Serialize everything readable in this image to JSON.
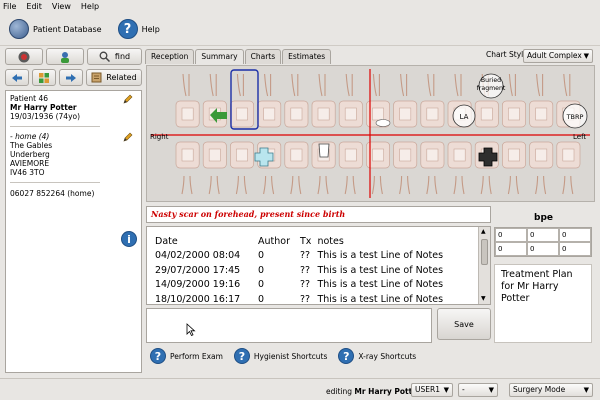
{
  "menu": [
    "File",
    "Edit",
    "View",
    "Help"
  ],
  "toolbar": {
    "patient_db": "Patient Database",
    "help": "Help"
  },
  "left": {
    "find_label": "find",
    "related_label": "Related",
    "patient_number": "Patient 46",
    "patient_name": "Mr Harry Potter",
    "patient_dob": "19/03/1936 (74yo)",
    "address_type": "- home (4)",
    "address_lines": [
      "The Gables",
      "Underberg",
      "AVIEMORE",
      "IV46 3TO"
    ],
    "phone": "06027 852264 (home)"
  },
  "tabs": [
    "Reception",
    "Summary",
    "Charts",
    "Estimates"
  ],
  "active_tab": "Summary",
  "chart_style": {
    "label": "Chart Style",
    "value": "Adult Complex"
  },
  "chart": {
    "right_label": "Right",
    "left_label": "Left",
    "annotations": [
      "Buried fragment",
      "LA",
      "TBRP"
    ]
  },
  "memo": "Nasty scar on forehead, present since birth",
  "bpe": {
    "title": "bpe",
    "values": [
      "0",
      "0",
      "0",
      "0",
      "0",
      "0"
    ]
  },
  "notes": {
    "headers": [
      "Date",
      "Author",
      "Tx",
      "notes"
    ],
    "rows": [
      [
        "04/02/2000 08:04",
        "0",
        "??",
        "This is a test Line of Notes"
      ],
      [
        "29/07/2000 17:45",
        "0",
        "??",
        "This is a test Line of Notes"
      ],
      [
        "14/09/2000 19:16",
        "0",
        "??",
        "This is a test Line of Notes"
      ],
      [
        "18/10/2000 16:17",
        "0",
        "??",
        "This is a test Line of Notes"
      ]
    ]
  },
  "treatment_plan": "Treatment Plan for Mr Harry Potter",
  "save_label": "Save",
  "shortcuts": [
    "Perform Exam",
    "Hygienist Shortcuts",
    "X-ray Shortcuts"
  ],
  "status": {
    "editing_prefix": "editing",
    "editing_name": "Mr Harry Potter",
    "user": "USER1",
    "second": "-",
    "mode": "Surgery Mode"
  },
  "colors": {
    "midline": "#dd0000",
    "selection": "#1b2fa8",
    "memo_text": "#cc0000",
    "accent_blue": "#2f6fb2"
  }
}
